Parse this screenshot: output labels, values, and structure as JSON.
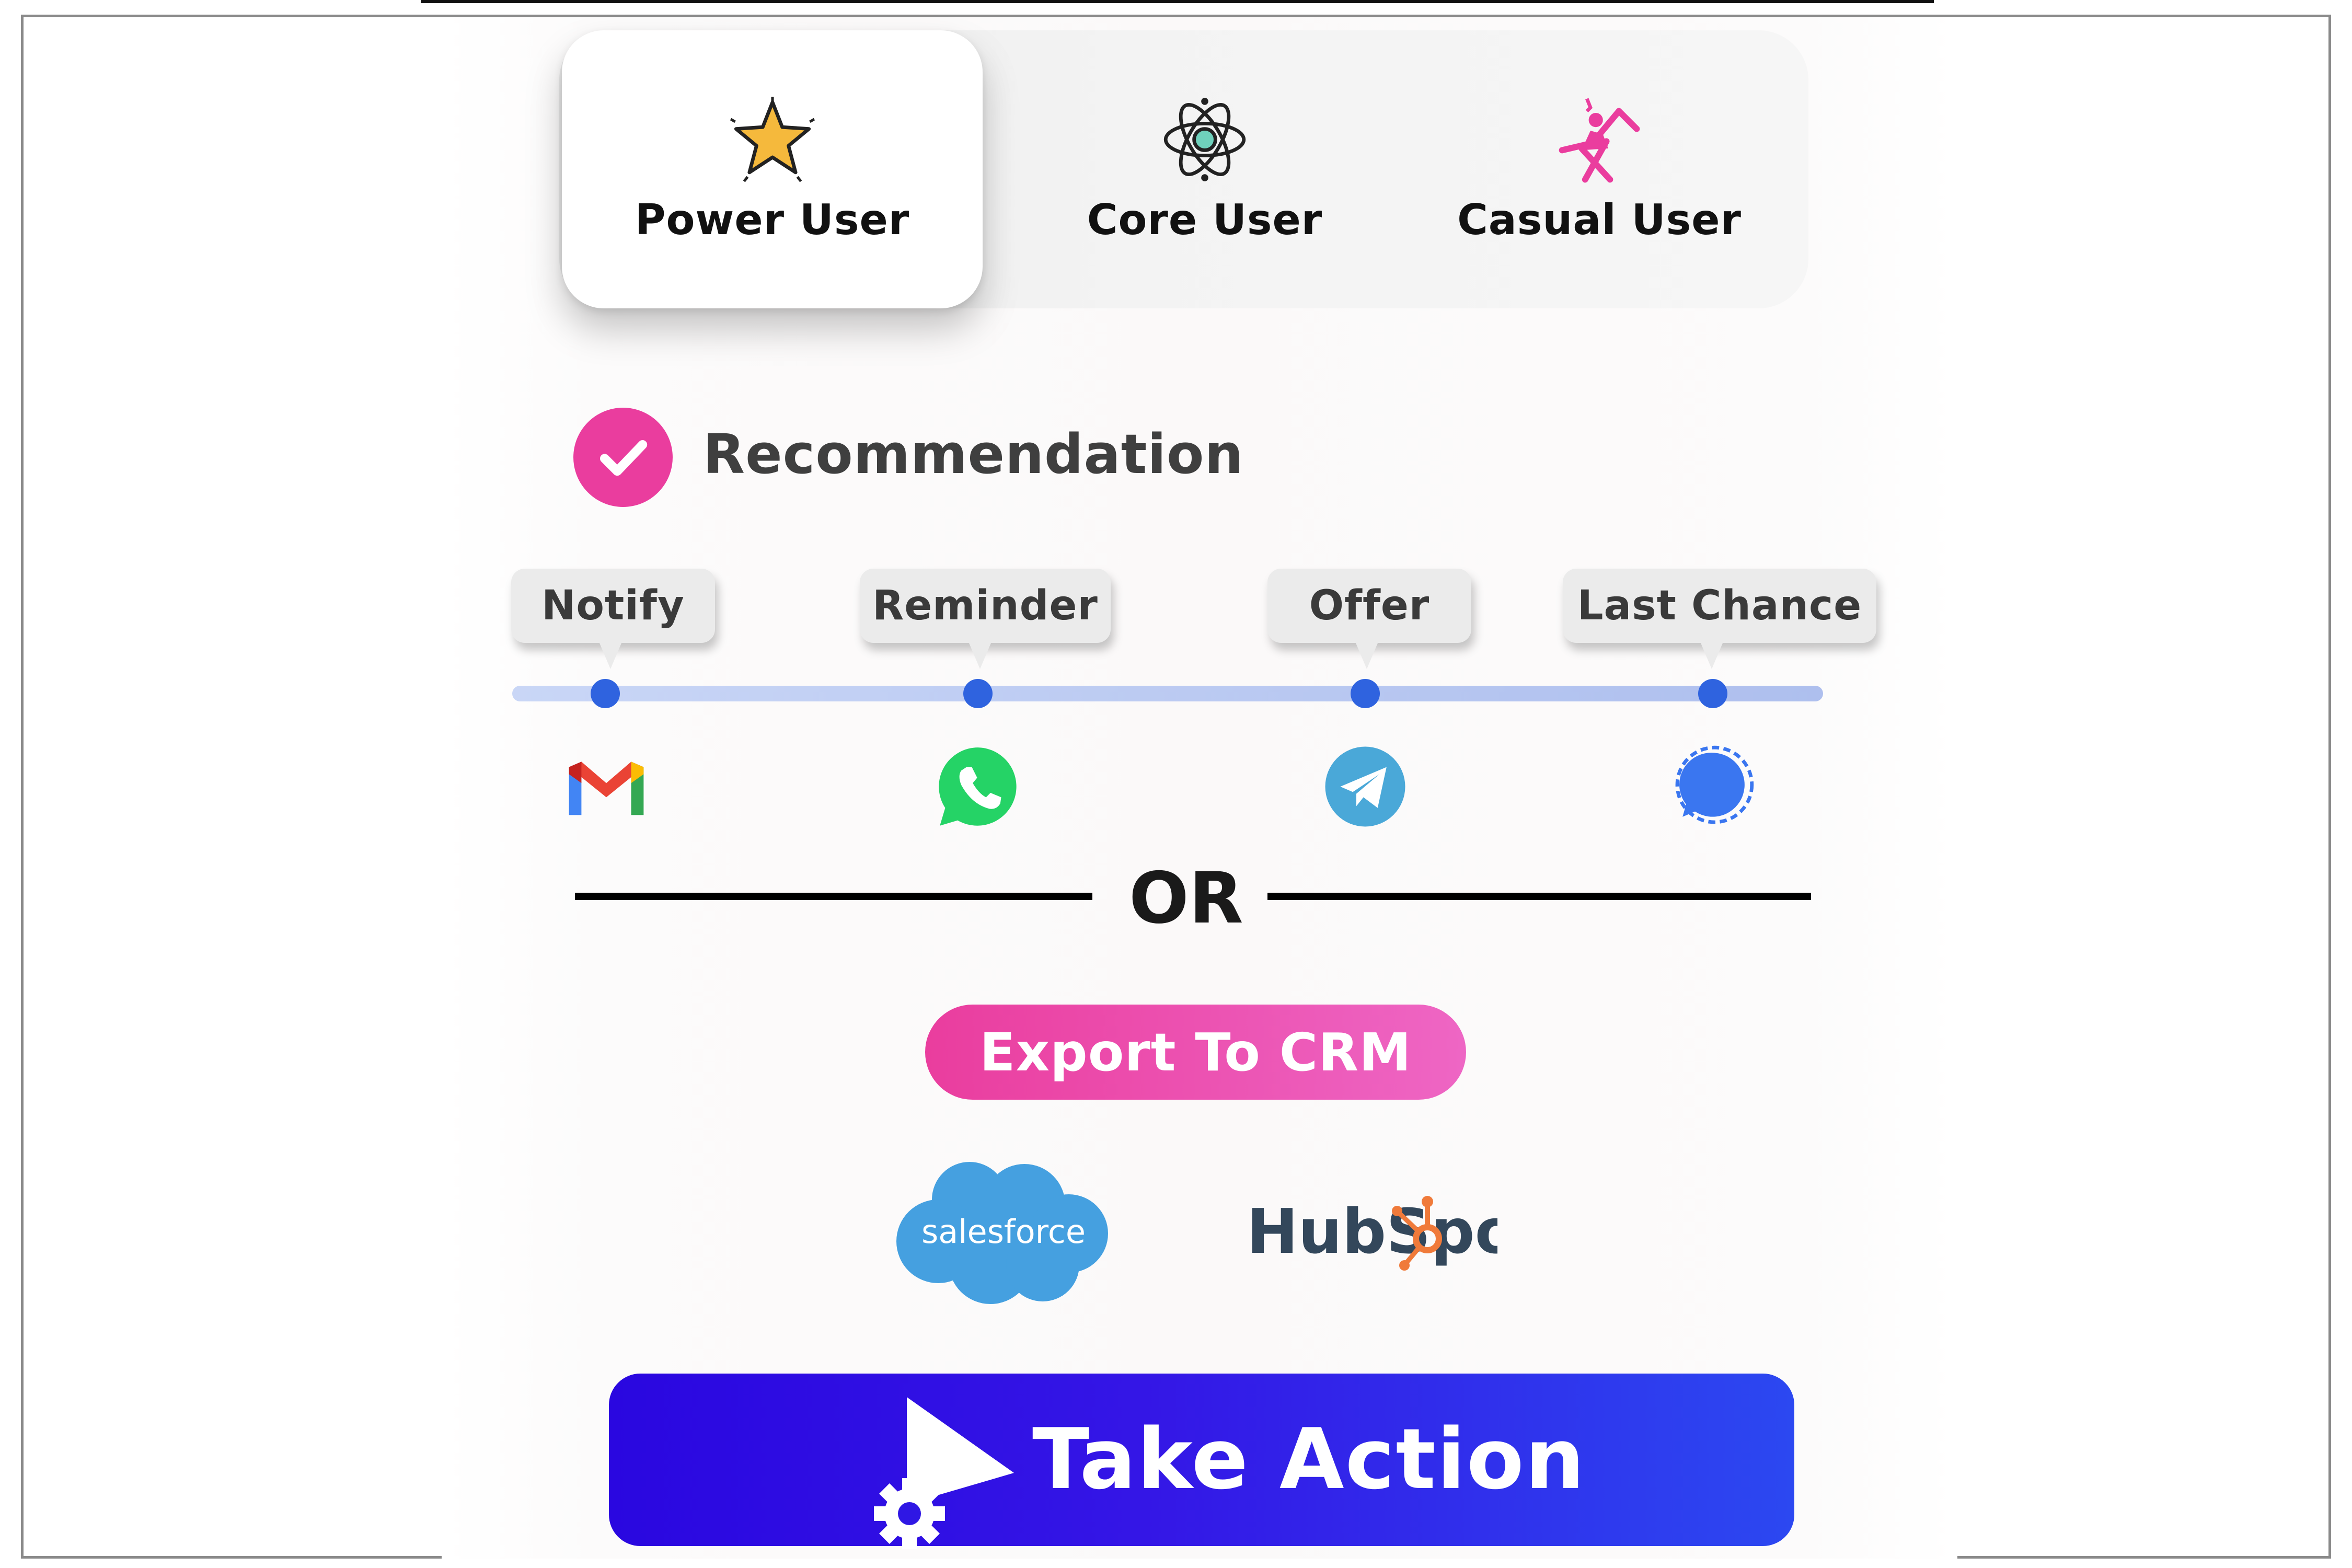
{
  "segments": [
    {
      "label": "Power User",
      "icon": "star-icon",
      "active": true
    },
    {
      "label": "Core User",
      "icon": "atom-icon",
      "active": false
    },
    {
      "label": "Casual User",
      "icon": "lounge-chair-icon",
      "active": false
    }
  ],
  "recommendation": {
    "label": "Recommendation",
    "checked": true
  },
  "timeline": [
    {
      "label": "Notify",
      "channel": "gmail-icon"
    },
    {
      "label": "Reminder",
      "channel": "whatsapp-icon"
    },
    {
      "label": "Offer",
      "channel": "telegram-icon"
    },
    {
      "label": "Last Chance",
      "channel": "signal-icon"
    }
  ],
  "divider": {
    "text": "OR"
  },
  "export": {
    "label": "Export To CRM"
  },
  "crms": [
    {
      "label": "salesforce",
      "icon": "salesforce-logo"
    },
    {
      "label": "HubSpot",
      "icon": "hubspot-logo"
    }
  ],
  "action": {
    "label": "Take Action",
    "icon": "play-gear-icon"
  },
  "colors": {
    "accent_pink": "#ea3d9e",
    "timeline_dot": "#2f63df",
    "action_gradient_start": "#2a07e0",
    "action_gradient_end": "#2c48f1",
    "salesforce_blue": "#45a0e0",
    "hubspot_orange": "#f07a3a"
  }
}
